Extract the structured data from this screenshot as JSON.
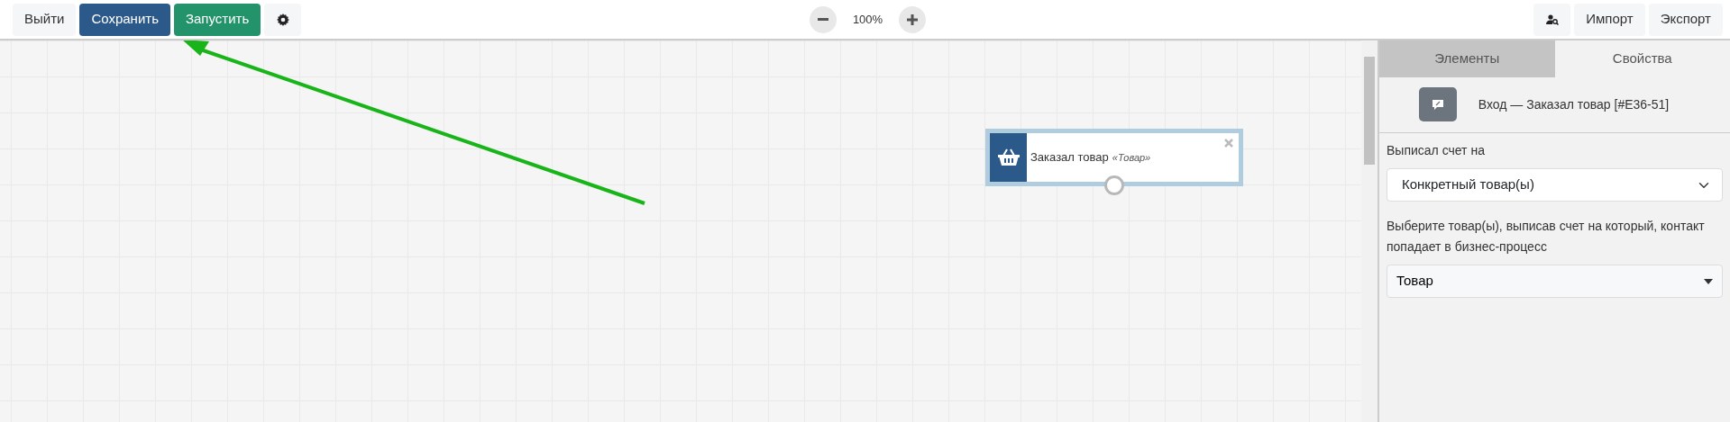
{
  "toolbar": {
    "left_buttons": [
      {
        "kind": "light",
        "label": "Выйти"
      },
      {
        "kind": "primary",
        "label": "Сохранить"
      },
      {
        "kind": "success",
        "label": "Запустить"
      },
      {
        "kind": "settings"
      }
    ],
    "zoom": {
      "value": "100%"
    },
    "right_buttons": [
      {
        "kind": "user-search"
      },
      {
        "kind": "light",
        "label": "Импорт"
      },
      {
        "kind": "light",
        "label": "Экспорт"
      }
    ]
  },
  "canvas": {
    "node": {
      "title": "Заказал товар",
      "subtitle": "«Товар»"
    }
  },
  "panel": {
    "tabs": [
      {
        "label": "Элементы",
        "selected": false
      },
      {
        "label": "Свойства",
        "selected": true
      }
    ],
    "header": "Вход — Заказал товар [#E36-51]",
    "fields": [
      {
        "kind": "select",
        "label": "Выписал счет на",
        "value": "Конкретный товар(ы)"
      },
      {
        "kind": "dropdown",
        "label": "Выберите товар(ы), выписав счет на который, контакт попадает в бизнес-процесс",
        "value": "Товар"
      }
    ]
  }
}
